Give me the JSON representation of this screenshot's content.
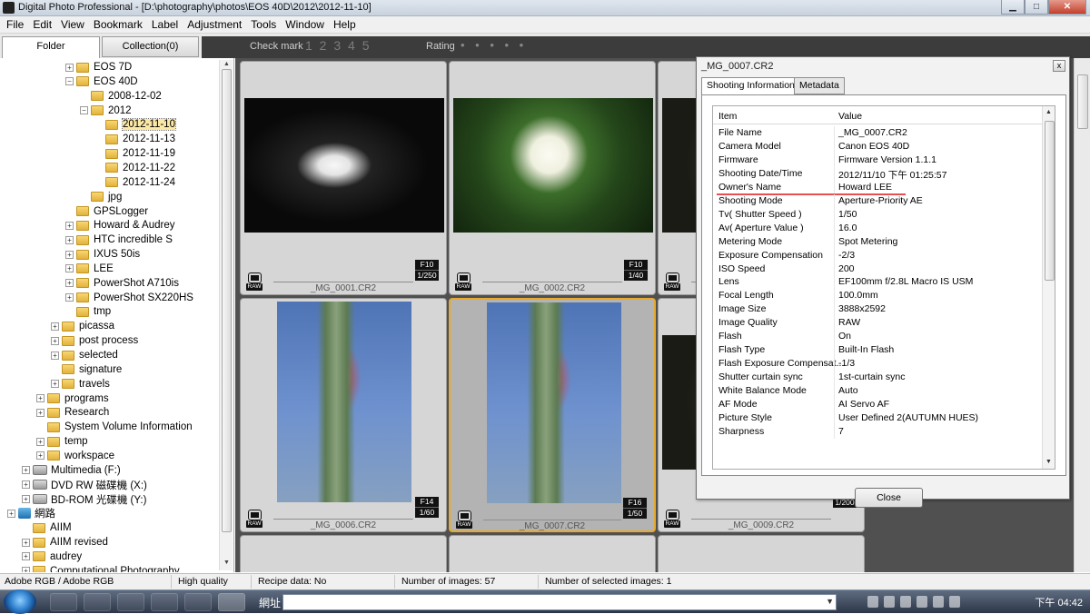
{
  "window": {
    "title": "Digital Photo Professional - [D:\\photography\\photos\\EOS 40D\\2012\\2012-11-10]",
    "minimize": "▁",
    "maximize": "□",
    "close": "✕"
  },
  "menu": [
    "File",
    "Edit",
    "View",
    "Bookmark",
    "Label",
    "Adjustment",
    "Tools",
    "Window",
    "Help"
  ],
  "tabs": {
    "folder": "Folder",
    "collection": "Collection(0)"
  },
  "markbar": {
    "check_mark_label": "Check mark",
    "check_values": "1 2 3 4 5",
    "rating_label": "Rating",
    "rating_dots": "• • • • •"
  },
  "tree": [
    {
      "label": "EOS 7D",
      "type": "folder",
      "exp": "+"
    },
    {
      "label": "EOS 40D",
      "type": "folder",
      "exp": "−"
    },
    {
      "label": "2008-12-02",
      "type": "folder",
      "exp": ""
    },
    {
      "label": "2012",
      "type": "folder",
      "exp": "−"
    },
    {
      "label": "2012-11-10",
      "type": "folder",
      "exp": "",
      "selected": true
    },
    {
      "label": "2012-11-13",
      "type": "folder",
      "exp": ""
    },
    {
      "label": "2012-11-19",
      "type": "folder",
      "exp": ""
    },
    {
      "label": "2012-11-22",
      "type": "folder",
      "exp": ""
    },
    {
      "label": "2012-11-24",
      "type": "folder",
      "exp": ""
    },
    {
      "label": "jpg",
      "type": "folder",
      "exp": ""
    },
    {
      "label": "GPSLogger",
      "type": "folder",
      "exp": ""
    },
    {
      "label": "Howard & Audrey",
      "type": "folder",
      "exp": "+"
    },
    {
      "label": "HTC incredible S",
      "type": "folder",
      "exp": "+"
    },
    {
      "label": "IXUS 50is",
      "type": "folder",
      "exp": "+"
    },
    {
      "label": "LEE",
      "type": "folder",
      "exp": "+"
    },
    {
      "label": "PowerShot A710is",
      "type": "folder",
      "exp": "+"
    },
    {
      "label": "PowerShot SX220HS",
      "type": "folder",
      "exp": "+"
    },
    {
      "label": "tmp",
      "type": "folder",
      "exp": ""
    },
    {
      "label": "picassa",
      "type": "folder",
      "exp": "+"
    },
    {
      "label": "post process",
      "type": "folder",
      "exp": "+"
    },
    {
      "label": "selected",
      "type": "folder",
      "exp": "+"
    },
    {
      "label": "signature",
      "type": "folder",
      "exp": ""
    },
    {
      "label": "travels",
      "type": "folder",
      "exp": "+"
    },
    {
      "label": "programs",
      "type": "folder",
      "exp": "+"
    },
    {
      "label": "Research",
      "type": "folder",
      "exp": "+"
    },
    {
      "label": "System Volume Information",
      "type": "folder",
      "exp": ""
    },
    {
      "label": "temp",
      "type": "folder",
      "exp": "+"
    },
    {
      "label": "workspace",
      "type": "folder",
      "exp": "+"
    },
    {
      "label": "Multimedia (F:)",
      "type": "drive",
      "exp": "+"
    },
    {
      "label": "DVD RW 磁碟機 (X:)",
      "type": "drive",
      "exp": "+"
    },
    {
      "label": "BD-ROM 光碟機 (Y:)",
      "type": "drive",
      "exp": "+"
    },
    {
      "label": "網路",
      "type": "network",
      "exp": "+"
    },
    {
      "label": "AIIM",
      "type": "folder",
      "exp": ""
    },
    {
      "label": "AIIM revised",
      "type": "folder",
      "exp": "+"
    },
    {
      "label": "audrey",
      "type": "folder",
      "exp": "+"
    },
    {
      "label": "Computational Photography",
      "type": "folder",
      "exp": "+"
    }
  ],
  "thumbnails": [
    {
      "file": "_MG_0001.CR2",
      "aperture": "F10",
      "shutter": "1/250",
      "raw": "RAW",
      "style": "dark"
    },
    {
      "file": "_MG_0002.CR2",
      "aperture": "F10",
      "shutter": "1/40",
      "raw": "RAW",
      "style": "orange"
    },
    {
      "file": "",
      "aperture": "",
      "shutter": "",
      "raw": "RAW",
      "style": "dimdark"
    },
    {
      "file": "_MG_0006.CR2",
      "aperture": "F14",
      "shutter": "1/60",
      "raw": "RAW",
      "style": "plant"
    },
    {
      "file": "_MG_0007.CR2",
      "aperture": "F16",
      "shutter": "1/50",
      "raw": "RAW",
      "style": "plant",
      "selected": true
    },
    {
      "file": "_MG_0009.CR2",
      "aperture": "",
      "shutter": "1/200",
      "raw": "RAW",
      "style": "dimdark"
    }
  ],
  "dialog": {
    "title": "_MG_0007.CR2",
    "close_x": "x",
    "tab_shooting": "Shooting Information",
    "tab_metadata": "Metadata",
    "col_item": "Item",
    "col_value": "Value",
    "rows": [
      {
        "k": "File Name",
        "v": "_MG_0007.CR2"
      },
      {
        "k": "Camera Model",
        "v": "Canon EOS 40D"
      },
      {
        "k": "Firmware",
        "v": "Firmware Version 1.1.1"
      },
      {
        "k": "Shooting Date/Time",
        "v": "2012/11/10 下午 01:25:57"
      },
      {
        "k": "Owner's Name",
        "v": "Howard LEE"
      },
      {
        "k": "Shooting Mode",
        "v": "Aperture-Priority AE"
      },
      {
        "k": "Tv( Shutter Speed )",
        "v": "1/50"
      },
      {
        "k": "Av( Aperture Value )",
        "v": "16.0"
      },
      {
        "k": "Metering Mode",
        "v": "Spot Metering"
      },
      {
        "k": "Exposure Compensation",
        "v": "-2/3"
      },
      {
        "k": "ISO Speed",
        "v": "200"
      },
      {
        "k": "Lens",
        "v": "EF100mm f/2.8L Macro IS USM"
      },
      {
        "k": "Focal Length",
        "v": "100.0mm"
      },
      {
        "k": "Image Size",
        "v": "3888x2592"
      },
      {
        "k": "Image Quality",
        "v": "RAW"
      },
      {
        "k": "Flash",
        "v": "On"
      },
      {
        "k": "Flash Type",
        "v": "Built-In Flash"
      },
      {
        "k": "Flash Exposure Compensat...",
        "v": "-1/3"
      },
      {
        "k": "Shutter curtain sync",
        "v": "1st-curtain sync"
      },
      {
        "k": "White Balance Mode",
        "v": "Auto"
      },
      {
        "k": "AF Mode",
        "v": "AI Servo AF"
      },
      {
        "k": "Picture Style",
        "v": "User Defined 2(AUTUMN HUES)"
      },
      {
        "k": "Sharpness",
        "v": "7"
      }
    ],
    "close_button": "Close"
  },
  "status": {
    "color_space": "Adobe RGB / Adobe RGB",
    "quality": "High quality",
    "recipe": "Recipe data: No",
    "num_images": "Number of images: 57",
    "num_selected": "Number of selected images: 1"
  },
  "taskbar": {
    "address_label": "網址",
    "clock": "下午 04:42"
  }
}
